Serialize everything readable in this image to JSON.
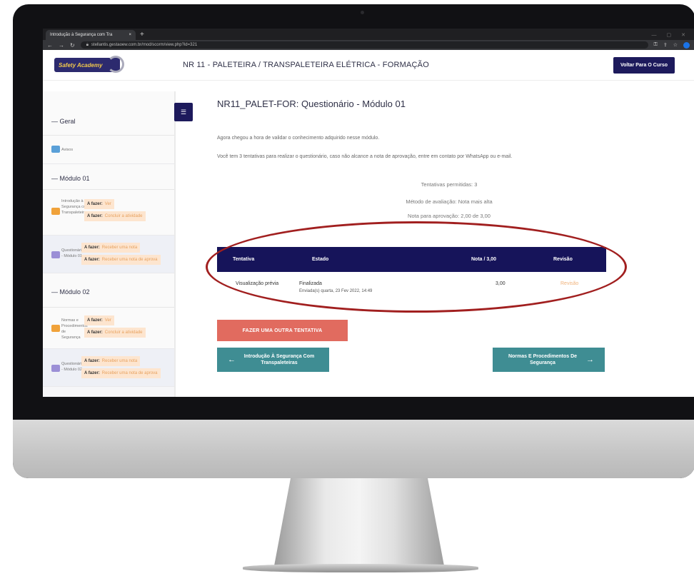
{
  "browser": {
    "tab_title": "Introdução à Segurança com Tra",
    "tab_close": "×",
    "new_tab": "+",
    "url": "stellantis.gestaoew.com.br/mod/scorm/view.php?id=321"
  },
  "header": {
    "logo_text": "Safety Academy",
    "course_title": "NR 11 - PALETEIRA / TRANSPALETEIRA ELÉTRICA - FORMAÇÃO",
    "back_button": "Voltar Para O Curso"
  },
  "sidebar": {
    "section_geral": "— Geral",
    "avisos": "Avisos",
    "section_mod1": "— Módulo 01",
    "section_mod2": "— Módulo 02",
    "item1_label": "Introdução à Segurança com Transpaleteiras",
    "item2_label": "Questionário - Módulo 01",
    "item3_label": "Normas e Procedimentos de Segurança",
    "item4_label": "Questionário - Módulo 02",
    "todo_prefix": "A fazer:",
    "todo_ver": "Ver",
    "todo_concluir": "Concluir a atividade",
    "todo_receber_nota": "Receber uma nota",
    "todo_receber_aprov": "Receber uma nota de aprova"
  },
  "main": {
    "title": "NR11_PALET-FOR: Questionário - Módulo 01",
    "intro1": "Agora chegou a hora de validar o conhecimento adquirido nesse módulo.",
    "intro2": "Você tem 3 tentativas para realizar o questionário, caso não alcance a nota de aprovação, entre em contato por WhatsApp ou e-mail.",
    "tentativas": "Tentativas permitidas: 3",
    "metodo": "Método de avaliação: Nota mais alta",
    "nota_aprovacao": "Nota para aprovação: 2,00 de 3,00",
    "table": {
      "headers": [
        "Tentativa",
        "Estado",
        "Nota / 3,00",
        "Revisão"
      ],
      "row": {
        "tentativa": "Visualização prévia",
        "estado": "Finalizada",
        "enviada": "Enviada(s) quarta, 23 Fev 2022, 14:49",
        "nota": "3,00",
        "revisao": "Revisão"
      }
    },
    "retry_button": "FAZER UMA OUTRA TENTATIVA",
    "prev_button": "Introdução À Segurança Com Transpaleteiras",
    "next_button": "Normas E Procedimentos De Segurança"
  },
  "colors": {
    "navy": "#16145a",
    "retry": "#e16b5f",
    "teal": "#3f8d93",
    "highlight": "#a11f1f"
  }
}
